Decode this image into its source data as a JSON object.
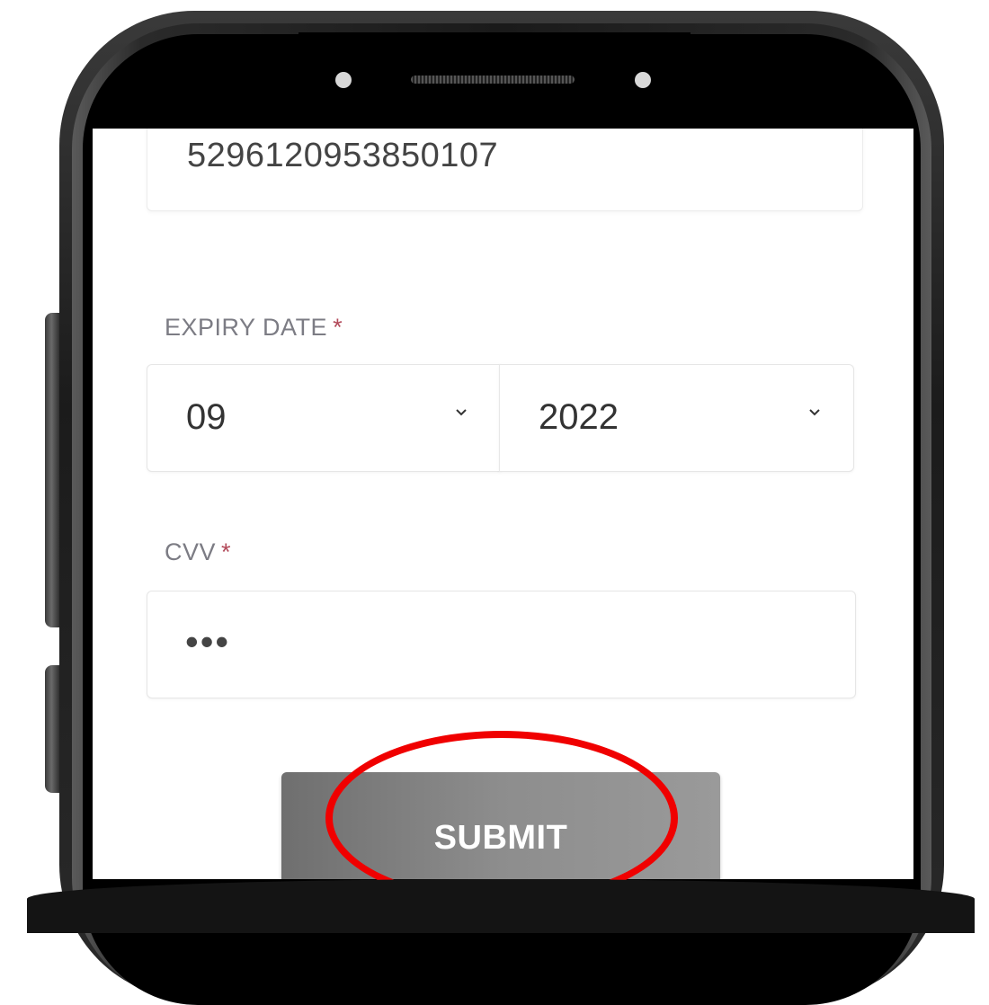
{
  "payment_form": {
    "card_number": "5296120953850107",
    "expiry": {
      "label": "EXPIRY DATE",
      "required_marker": "*",
      "month": "09",
      "year": "2022"
    },
    "cvv": {
      "label": "CVV",
      "required_marker": "*",
      "masked_value": "•••"
    },
    "submit_label": "SUBMIT"
  },
  "icons": {
    "month_dropdown": "chevron-down-icon",
    "year_dropdown": "chevron-down-icon"
  },
  "colors": {
    "required": "#b24a5a",
    "submit_bg": "#8d8d8d",
    "highlight": "#f00000"
  }
}
